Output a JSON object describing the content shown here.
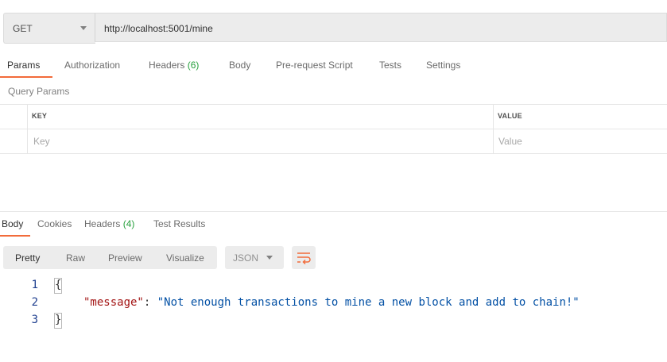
{
  "request": {
    "method": "GET",
    "url": "http://localhost:5001/mine"
  },
  "request_tabs": [
    {
      "label": "Params",
      "count": ""
    },
    {
      "label": "Authorization",
      "count": ""
    },
    {
      "label": "Headers",
      "count": "(6)"
    },
    {
      "label": "Body",
      "count": ""
    },
    {
      "label": "Pre-request Script",
      "count": ""
    },
    {
      "label": "Tests",
      "count": ""
    },
    {
      "label": "Settings",
      "count": ""
    }
  ],
  "params": {
    "section_label": "Query Params",
    "columns": [
      "KEY",
      "VALUE"
    ],
    "placeholders": {
      "key": "Key",
      "value": "Value"
    }
  },
  "response_tabs": [
    {
      "label": "Body",
      "count": ""
    },
    {
      "label": "Cookies",
      "count": ""
    },
    {
      "label": "Headers",
      "count": "(4)"
    },
    {
      "label": "Test Results",
      "count": ""
    }
  ],
  "view_modes": [
    "Pretty",
    "Raw",
    "Preview",
    "Visualize"
  ],
  "format": "JSON",
  "wrap_icon": "wrap-lines-icon",
  "response_body": {
    "line_numbers": [
      "1",
      "2",
      "3"
    ],
    "open_brace": "{",
    "close_brace": "}",
    "key": "\"message\"",
    "colon": ": ",
    "value": "\"Not enough transactions to mine a new block and add to chain!\""
  },
  "colors": {
    "accent": "#f26b3a",
    "count_green": "#26a03c",
    "json_key": "#a31515",
    "json_string": "#0451a5"
  }
}
